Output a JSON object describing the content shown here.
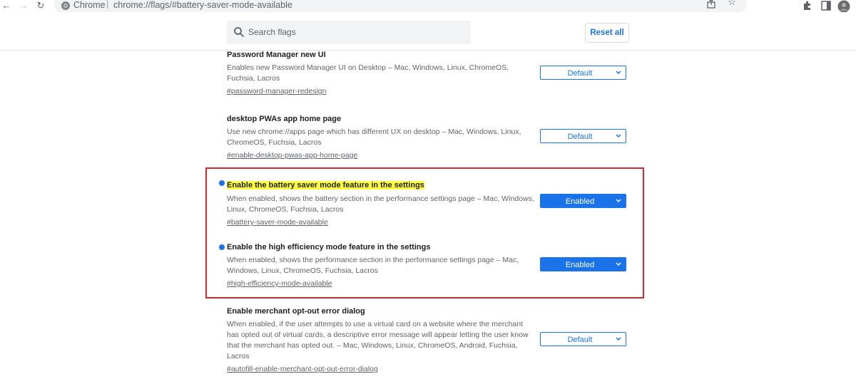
{
  "browser": {
    "url_scheme": "Chrome",
    "url_path": "chrome://flags/#battery-saver-mode-available"
  },
  "search": {
    "placeholder": "Search flags"
  },
  "reset_label": "Reset all",
  "flags": [
    {
      "title": "Password Manager new UI",
      "description": "Enables new Password Manager UI on Desktop – Mac, Windows, Linux, ChromeOS, Fuchsia, Lacros",
      "link": "#password-manager-redesign",
      "state": "Default"
    },
    {
      "title": "desktop PWAs app home page",
      "description": "Use new chrome://apps page which has different UX on desktop – Mac, Windows, Linux, ChromeOS, Fuchsia, Lacros",
      "link": "#enable-desktop-pwas-app-home-page",
      "state": "Default"
    },
    {
      "title": "Enable the battery saver mode feature in the settings",
      "description": "When enabled, shows the battery section in the performance settings page – Mac, Windows, Linux, ChromeOS, Fuchsia, Lacros",
      "link": "#battery-saver-mode-available",
      "state": "Enabled"
    },
    {
      "title": "Enable the high efficiency mode feature in the settings",
      "description": "When enabled, shows the performance section in the performance settings page – Mac, Windows, Linux, ChromeOS, Fuchsia, Lacros",
      "link": "#high-efficiency-mode-available",
      "state": "Enabled"
    },
    {
      "title": "Enable merchant opt-out error dialog",
      "description": "When enabled, if the user attempts to use a virtual card on a website where the merchant has opted out of virtual cards, a descriptive error message will appear letting the user know that the merchant has opted out. – Mac, Windows, Linux, ChromeOS, Android, Fuchsia, Lacros",
      "link": "#autofill-enable-merchant-opt-out-error-dialog",
      "state": "Default"
    }
  ],
  "colors": {
    "accent": "#1a73e8",
    "highlight": "#ffff3d",
    "annotation_border": "#d9262c"
  }
}
